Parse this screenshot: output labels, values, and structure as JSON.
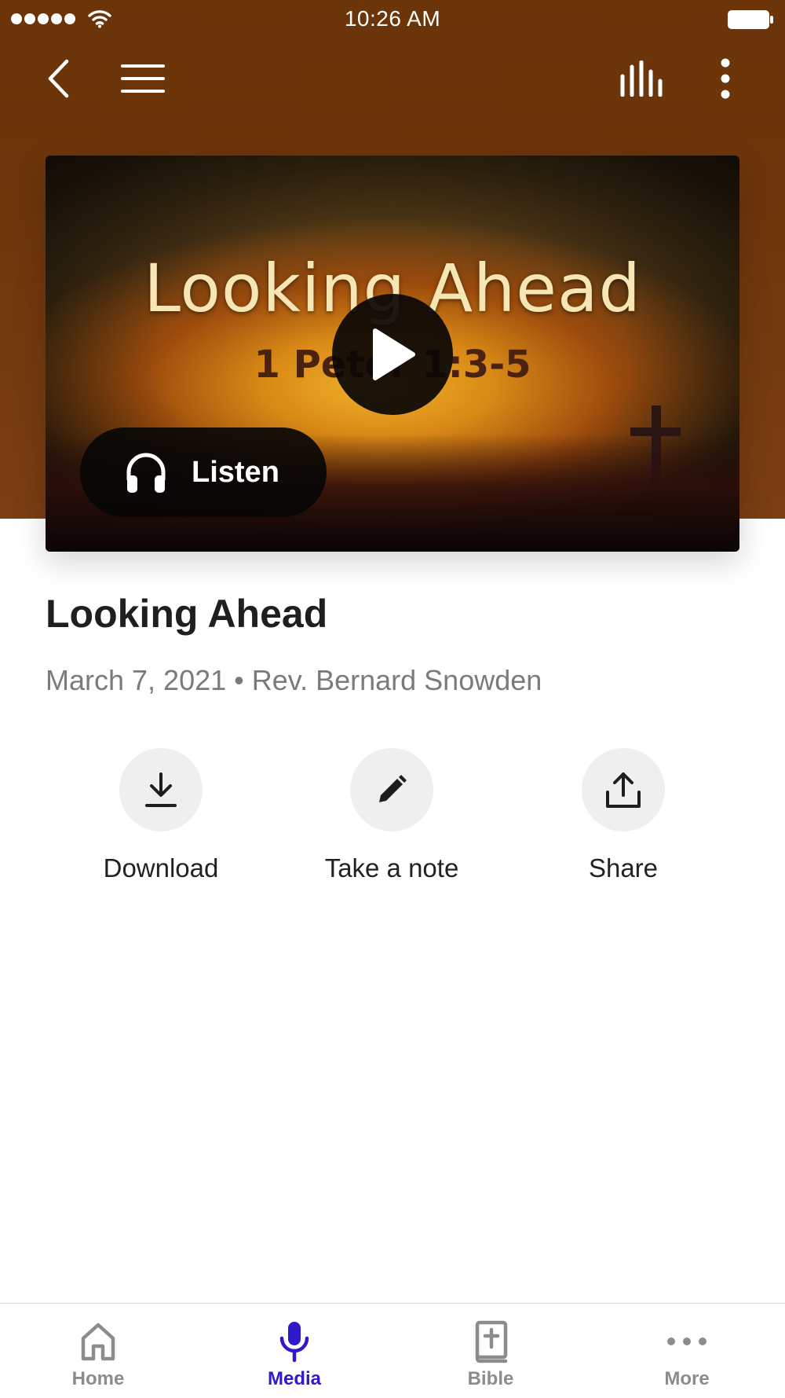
{
  "status_bar": {
    "time": "10:26 AM"
  },
  "hero": {
    "artwork_title": "Looking Ahead",
    "artwork_subtitle": "1 Peter 1:3-5",
    "listen_label": "Listen"
  },
  "media": {
    "title": "Looking Ahead",
    "meta": "March 7, 2021 • Rev. Bernard Snowden"
  },
  "actions": [
    {
      "label": "Download",
      "icon": "download-icon"
    },
    {
      "label": "Take a note",
      "icon": "pencil-icon"
    },
    {
      "label": "Share",
      "icon": "share-icon"
    }
  ],
  "tabs": [
    {
      "label": "Home",
      "icon": "home-icon",
      "active": false
    },
    {
      "label": "Media",
      "icon": "microphone-icon",
      "active": true
    },
    {
      "label": "Bible",
      "icon": "bible-icon",
      "active": false
    },
    {
      "label": "More",
      "icon": "more-dots-icon",
      "active": false
    }
  ],
  "colors": {
    "header": "#6f360c",
    "active_tab": "#2f1acb",
    "inactive_tab": "#8c8c8c",
    "action_circle": "#efeff0"
  }
}
